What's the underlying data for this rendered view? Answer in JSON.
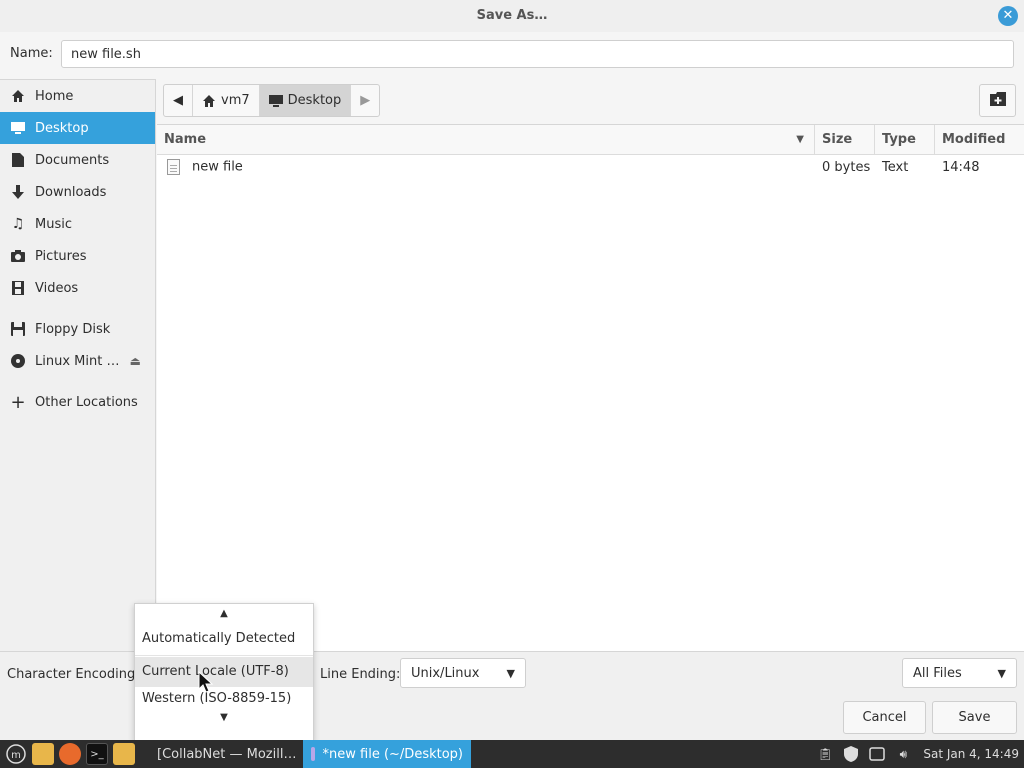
{
  "dialog": {
    "title": "Save As…",
    "name_label": "Name:",
    "name_value": "new file.sh"
  },
  "sidebar": {
    "items": [
      {
        "label": "Home",
        "icon": "home-icon"
      },
      {
        "label": "Desktop",
        "icon": "desktop-icon",
        "active": true
      },
      {
        "label": "Documents",
        "icon": "documents-icon"
      },
      {
        "label": "Downloads",
        "icon": "downloads-icon"
      },
      {
        "label": "Music",
        "icon": "music-icon"
      },
      {
        "label": "Pictures",
        "icon": "pictures-icon"
      },
      {
        "label": "Videos",
        "icon": "videos-icon"
      },
      {
        "label": "Floppy Disk",
        "icon": "floppy-icon"
      },
      {
        "label": "Linux Mint …",
        "icon": "disc-icon"
      },
      {
        "label": "Other Locations",
        "icon": "plus-icon"
      }
    ]
  },
  "pathbar": {
    "segments": [
      {
        "label": "vm7",
        "icon": "home-icon"
      },
      {
        "label": "Desktop",
        "icon": "desktop-icon",
        "current": true
      }
    ]
  },
  "filelist": {
    "columns": [
      "Name",
      "Size",
      "Type",
      "Modified"
    ],
    "rows": [
      {
        "name": "new file",
        "size": "0 bytes",
        "type": "Text",
        "modified": "14:48"
      }
    ]
  },
  "bottom": {
    "encoding_label": "Character Encoding:",
    "line_ending_label": "Line Ending:",
    "line_ending_value": "Unix/Linux",
    "filter_value": "All Files",
    "cancel_label": "Cancel",
    "save_label": "Save"
  },
  "encoding_popup": {
    "options": [
      "Automatically Detected",
      "Current Locale (UTF-8)",
      "Western (ISO-8859-15)"
    ],
    "hovered_index": 1
  },
  "taskbar": {
    "tasks": [
      {
        "label": "[CollabNet — Mozill…",
        "active": false
      },
      {
        "label": "*new file (~/Desktop)",
        "active": true
      }
    ],
    "clock": "Sat Jan  4, 14:49"
  },
  "colors": {
    "accent": "#35a1dc",
    "taskbar_bg": "#2d2d2d"
  }
}
